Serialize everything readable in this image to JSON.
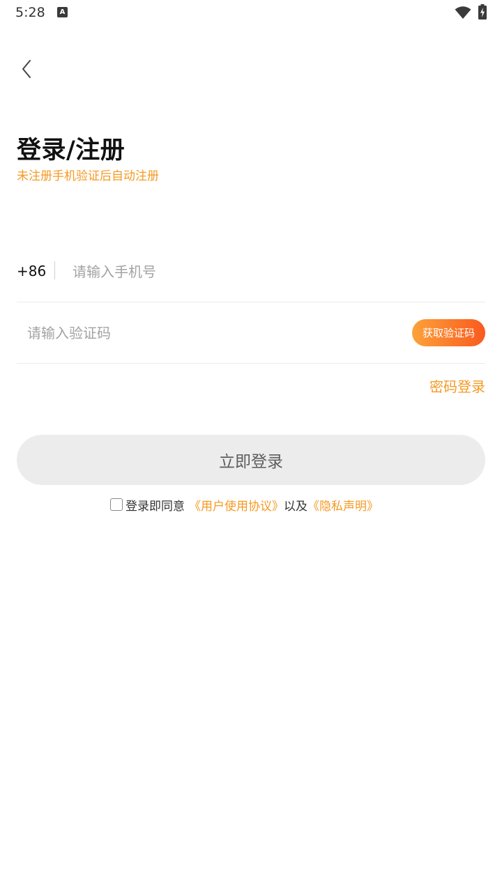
{
  "status_bar": {
    "time": "5:28",
    "notification_icon_letter": "A",
    "icons": [
      "a-notification-icon",
      "wifi-icon",
      "battery-charging-icon"
    ]
  },
  "header": {
    "back_icon": "chevron-left-icon"
  },
  "title": "登录/注册",
  "subtitle": "未注册手机验证后自动注册",
  "phone": {
    "country_code": "+86",
    "placeholder": "请输入手机号",
    "value": ""
  },
  "verification": {
    "placeholder": "请输入验证码",
    "value": "",
    "get_code_label": "获取验证码"
  },
  "password_login_label": "密码登录",
  "login_button_label": "立即登录",
  "agreement": {
    "checked": false,
    "prefix": "登录即同意",
    "user_agreement": "《用户使用协议》",
    "connector": "以及",
    "privacy": "《隐私声明》"
  },
  "colors": {
    "accent": "#f59a23",
    "button_gradient_start": "#fca23a",
    "button_gradient_end": "#fa5a1e",
    "login_button_bg": "#ececec"
  }
}
